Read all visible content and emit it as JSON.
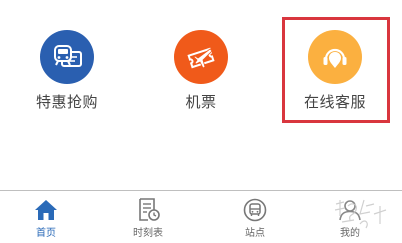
{
  "features": [
    {
      "label": "特惠抢购",
      "icon": "train-ticket-icon",
      "color": "#2a5fb0"
    },
    {
      "label": "机票",
      "icon": "flight-ticket-icon",
      "color": "#f05a1a"
    },
    {
      "label": "在线客服",
      "icon": "customer-service-icon",
      "color": "#fbb040"
    }
  ],
  "tabbar": {
    "items": [
      {
        "label": "首页",
        "icon": "home-icon",
        "active": true
      },
      {
        "label": "时刻表",
        "icon": "timetable-icon",
        "active": false
      },
      {
        "label": "站点",
        "icon": "bus-station-icon",
        "active": false
      },
      {
        "label": "我的",
        "icon": "profile-icon",
        "active": false
      }
    ]
  },
  "colors": {
    "accent": "#2a6ab8",
    "highlight": "#d9363e",
    "label": "#444444",
    "tab_label": "#666666"
  }
}
